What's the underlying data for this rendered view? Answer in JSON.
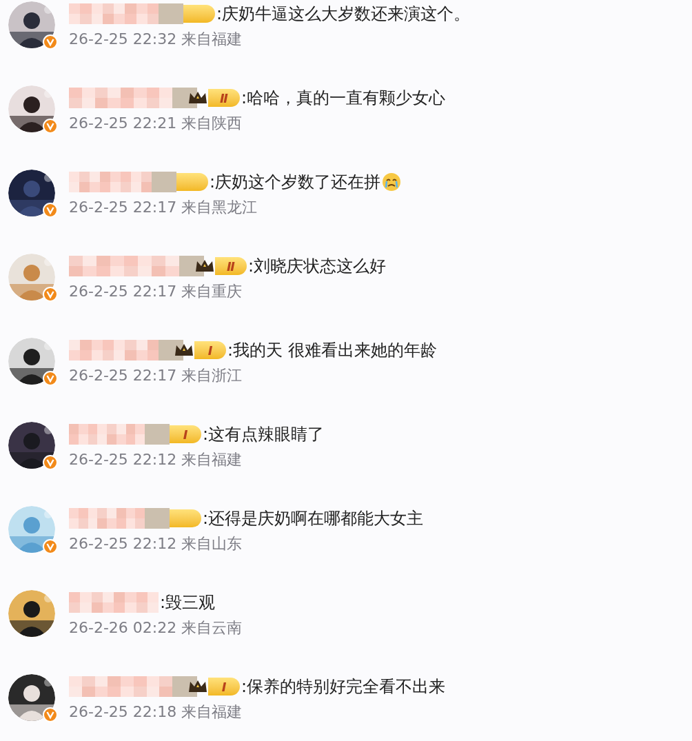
{
  "comments": [
    {
      "verified": true,
      "badge": {
        "crown": false
      },
      "text": ":庆奶牛逼这么大岁数还来演这个。",
      "emoji": false,
      "meta": "26-2-25 22:32 来自福建"
    },
    {
      "verified": true,
      "badge": {
        "crown": true,
        "label": "Ⅱ"
      },
      "text": ":哈哈，真的一直有颗少女心",
      "emoji": false,
      "meta": "26-2-25 22:21 来自陕西"
    },
    {
      "verified": true,
      "badge": {
        "crown": false
      },
      "text": ":庆奶这个岁数了还在拼",
      "emoji": true,
      "meta": "26-2-25 22:17 来自黑龙江"
    },
    {
      "verified": true,
      "badge": {
        "crown": true,
        "label": "Ⅱ"
      },
      "text": ":刘晓庆状态这么好",
      "emoji": false,
      "meta": "26-2-25 22:17 来自重庆"
    },
    {
      "verified": true,
      "badge": {
        "crown": true,
        "label": "I"
      },
      "text": ":我的天 很难看出来她的年龄",
      "emoji": false,
      "meta": "26-2-25 22:17 来自浙江"
    },
    {
      "verified": true,
      "badge": {
        "crown": false,
        "label": "I"
      },
      "text": ":这有点辣眼睛了",
      "emoji": false,
      "meta": "26-2-25 22:12 来自福建"
    },
    {
      "verified": true,
      "badge": {
        "crown": false
      },
      "text": ":还得是庆奶啊在哪都能大女主",
      "emoji": false,
      "meta": "26-2-25 22:12 来自山东"
    },
    {
      "verified": false,
      "text": ":毁三观",
      "emoji": false,
      "meta": "26-2-26 02:22 来自云南"
    },
    {
      "verified": true,
      "badge": {
        "crown": true,
        "label": "I"
      },
      "text": ":保养的特别好完全看不出来",
      "emoji": false,
      "meta": "26-2-25 22:18 来自福建"
    }
  ]
}
